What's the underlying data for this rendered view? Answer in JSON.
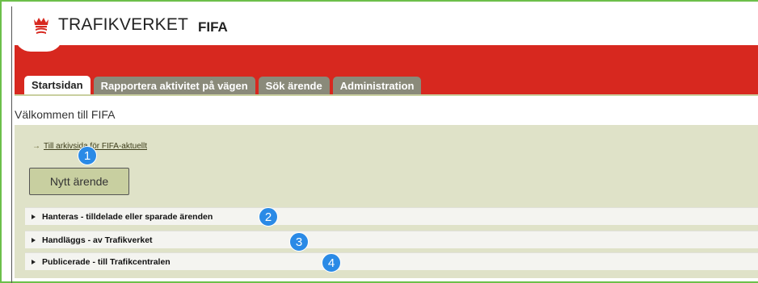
{
  "header": {
    "logo_text": "TRAFIKVERKET",
    "app_name": "FIFA"
  },
  "tabs": [
    {
      "label": "Startsidan",
      "active": true
    },
    {
      "label": "Rapportera aktivitet på vägen",
      "active": false
    },
    {
      "label": "Sök ärende",
      "active": false
    },
    {
      "label": "Administration",
      "active": false
    }
  ],
  "main": {
    "welcome": "Välkommen till FIFA",
    "link_text": "Till arkivsida för FIFA-aktuellt",
    "new_case_button": "Nytt ärende",
    "sections": [
      {
        "label": "Hanteras - tilldelade eller sparade ärenden"
      },
      {
        "label": "Handläggs - av Trafikverket"
      },
      {
        "label": "Publicerade - till Trafikcentralen"
      }
    ]
  },
  "badges": [
    "1",
    "2",
    "3",
    "4"
  ],
  "colors": {
    "brand_red": "#d7281f",
    "panel_bg": "#dfe2c8",
    "tab_inactive": "#8a8a7a",
    "badge_blue": "#2a8ae6",
    "frame_green": "#6cbf4a"
  },
  "icons": {
    "logo": "trafikverket-crown-icon",
    "link": "arrow-right-icon",
    "section": "triangle-right-icon"
  }
}
